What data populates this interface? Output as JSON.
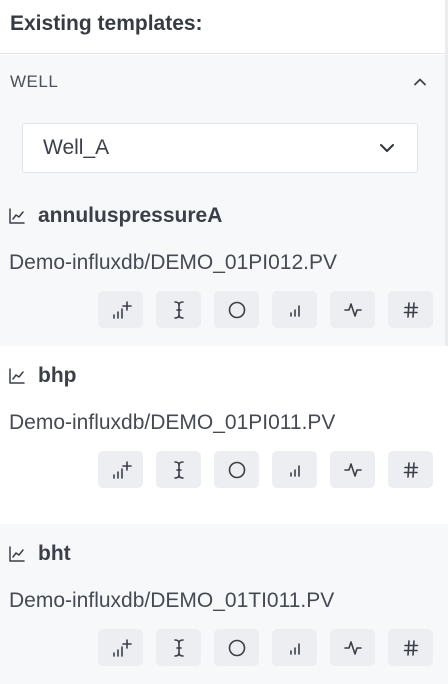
{
  "heading": "Existing templates:",
  "section": {
    "label": "WELL"
  },
  "select": {
    "value": "Well_A"
  },
  "templates": [
    {
      "name": "annuluspressureA",
      "source": "Demo-influxdb/DEMO_01PI012.PV"
    },
    {
      "name": "bhp",
      "source": "Demo-influxdb/DEMO_01PI011.PV"
    },
    {
      "name": "bht",
      "source": "Demo-influxdb/DEMO_01TI011.PV"
    }
  ],
  "actions": [
    {
      "name": "add-chart-button",
      "icon": "bar-chart-plus-icon"
    },
    {
      "name": "text-cursor-button",
      "icon": "text-cursor-icon"
    },
    {
      "name": "circle-button",
      "icon": "circle-icon"
    },
    {
      "name": "bar-chart-button",
      "icon": "bar-chart-icon"
    },
    {
      "name": "activity-button",
      "icon": "activity-icon"
    },
    {
      "name": "hash-button",
      "icon": "hash-icon"
    }
  ]
}
